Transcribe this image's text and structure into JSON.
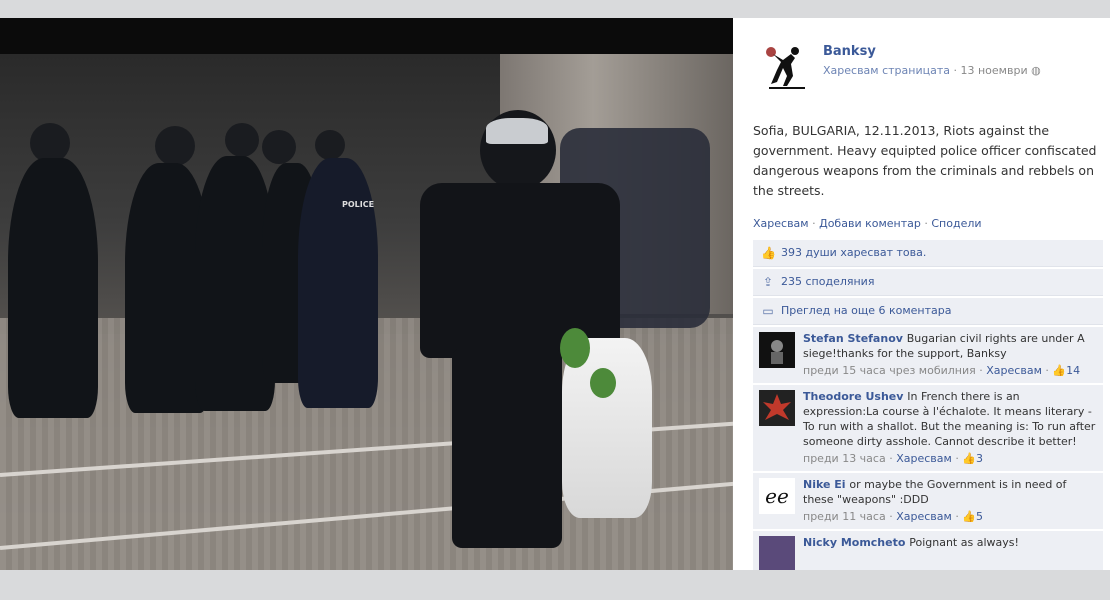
{
  "post": {
    "page_name": "Banksy",
    "like_page": "Харесвам страницата",
    "date": "13 ноември",
    "text": "Sofia, BULGARIA, 12.11.2013, Riots against the government. Heavy equipted police officer confiscated dangerous weapons from the criminals and rebbels on the streets.",
    "actions": {
      "like": "Харесвам",
      "comment": "Добави коментар",
      "share": "Сподели"
    }
  },
  "ufi": {
    "likes": "393 души харесват това.",
    "shares": "235 споделяния",
    "more_comments": "Преглед на още 6 коментара"
  },
  "comments": [
    {
      "name": "Stefan Stefanov",
      "text": "Bugarian civil rights are under A siege!thanks for the support, Banksy",
      "time": "преди 15 часа чрез мобилния",
      "like": "Харесвам",
      "count": "14"
    },
    {
      "name": "Theodore Ushev",
      "text": "In French there is an expression:La course à l'échalote. It means literary - To run with a shallot. But the meaning is: To run after someone dirty asshole. Cannot describe it better!",
      "time": "преди 13 часа",
      "like": "Харесвам",
      "count": "3"
    },
    {
      "name": "Nike Ei",
      "text": "or maybe the Government is in need of these \"weapons\" :DDD",
      "time": "преди 11 часа",
      "like": "Харесвам",
      "count": "5"
    },
    {
      "name": "Nicky Momcheto",
      "text": "Poignant as always!"
    }
  ],
  "photo_text": {
    "police_label": "POLICE"
  },
  "avatar_text": {
    "nike": "ee"
  },
  "colors": {
    "link": "#3b5998",
    "ufi_bg": "#edeff4"
  },
  "icons": {
    "likes": "thumbs-up-icon",
    "shares": "share-icon",
    "comments": "comment-bubble-icon",
    "globe": "globe-icon"
  }
}
